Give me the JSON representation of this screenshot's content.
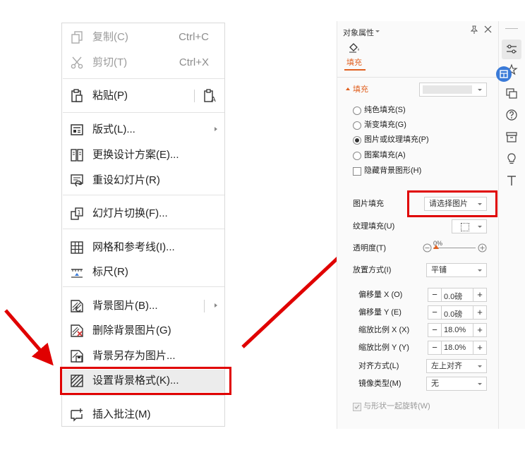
{
  "context_menu": {
    "items": [
      {
        "label": "复制(C)",
        "shortcut": "Ctrl+C",
        "icon": "copy-icon",
        "disabled": true
      },
      {
        "label": "剪切(T)",
        "shortcut": "Ctrl+X",
        "icon": "cut-icon",
        "disabled": true
      },
      {
        "label": "粘贴(P)",
        "icon": "paste-icon"
      },
      {
        "label": "版式(L)...",
        "icon": "layout-icon",
        "submenu": true
      },
      {
        "label": "更换设计方案(E)...",
        "icon": "design-icon"
      },
      {
        "label": "重设幻灯片(R)",
        "icon": "reset-slide-icon"
      },
      {
        "label": "幻灯片切换(F)...",
        "icon": "transition-icon"
      },
      {
        "label": "网格和参考线(I)...",
        "icon": "grid-icon"
      },
      {
        "label": "标尺(R)",
        "icon": "ruler-icon"
      },
      {
        "label": "背景图片(B)...",
        "icon": "background-image-icon",
        "submenu": true
      },
      {
        "label": "删除背景图片(G)",
        "icon": "delete-background-icon"
      },
      {
        "label": "背景另存为图片...",
        "icon": "save-background-icon"
      },
      {
        "label": "设置背景格式(K)...",
        "icon": "format-background-icon",
        "highlighted": true
      },
      {
        "label": "插入批注(M)",
        "icon": "comment-icon"
      }
    ]
  },
  "property_pane": {
    "title": "对象属性",
    "tab_label": "填充",
    "section_label": "填充",
    "fill_options": [
      "纯色填充(S)",
      "渐变填充(G)",
      "图片或纹理填充(P)",
      "图案填充(A)"
    ],
    "selected_fill": "图片或纹理填充(P)",
    "hide_background_label": "隐藏背景图形(H)",
    "picture_fill_label": "图片填充",
    "picture_fill_value": "请选择图片",
    "texture_label": "纹理填充(U)",
    "transparency_label": "透明度(T)",
    "transparency_value": "0%",
    "placement_label": "放置方式(I)",
    "placement_value": "平铺",
    "offset_x_label": "偏移量 X (O)",
    "offset_x_value": "0.0磅",
    "offset_y_label": "偏移量 Y (E)",
    "offset_y_value": "0.0磅",
    "scale_x_label": "缩放比例 X (X)",
    "scale_x_value": "18.0%",
    "scale_y_label": "缩放比例 Y (Y)",
    "scale_y_value": "18.0%",
    "align_label": "对齐方式(L)",
    "align_value": "左上对齐",
    "mirror_label": "镜像类型(M)",
    "mirror_value": "无",
    "rotate_label": "与形状一起旋转(W)"
  },
  "colors": {
    "highlight": "#e00000",
    "accent": "#e06020",
    "selected_tool": "#3a7ad8"
  }
}
